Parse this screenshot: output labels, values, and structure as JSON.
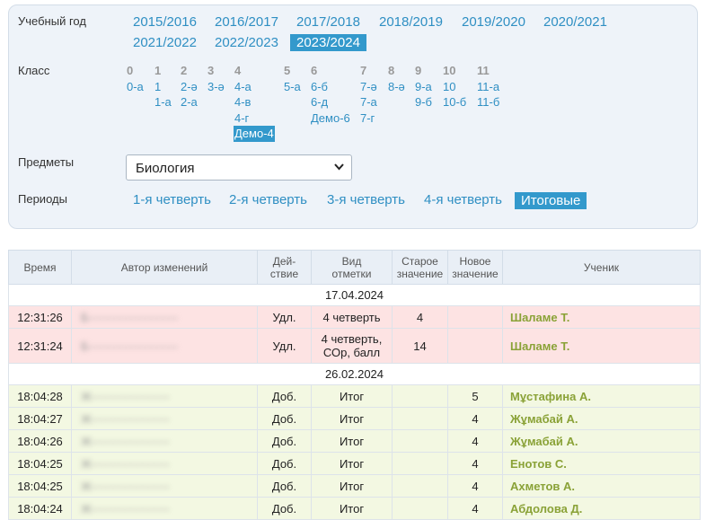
{
  "filters": {
    "year_label": "Учебный год",
    "years": [
      "2015/2016",
      "2016/2017",
      "2017/2018",
      "2018/2019",
      "2019/2020",
      "2020/2021",
      "2021/2022",
      "2022/2023",
      "2023/2024"
    ],
    "class_label": "Класс",
    "class_columns": [
      {
        "head": "0",
        "items": [
          "0-а"
        ]
      },
      {
        "head": "1",
        "items": [
          "1",
          "1-а"
        ]
      },
      {
        "head": "2",
        "items": [
          "2-ә",
          "2-а"
        ]
      },
      {
        "head": "3",
        "items": [
          "3-ә"
        ]
      },
      {
        "head": "4",
        "items": [
          "4-а",
          "4-в",
          "4-г",
          "Демо-4"
        ]
      },
      {
        "head": "5",
        "items": [
          "5-а"
        ]
      },
      {
        "head": "6",
        "items": [
          "6-б",
          "6-д",
          "Демо-6"
        ]
      },
      {
        "head": "7",
        "items": [
          "7-ә",
          "7-а",
          "7-г"
        ]
      },
      {
        "head": "8",
        "items": [
          "8-ә"
        ]
      },
      {
        "head": "9",
        "items": [
          "9-а",
          "9-б"
        ]
      },
      {
        "head": "10",
        "items": [
          "10",
          "10-б"
        ]
      },
      {
        "head": "11",
        "items": [
          "11-а",
          "11-б"
        ]
      }
    ],
    "subject_label": "Предметы",
    "subject_value": "Биология",
    "period_label": "Периоды",
    "periods": [
      "1-я четверть",
      "2-я четверть",
      "3-я четверть",
      "4-я четверть",
      "Итоговые"
    ]
  },
  "table": {
    "headers": {
      "time": "Время",
      "author": "Автор изменений",
      "action_1": "Дей-",
      "action_2": "ствие",
      "kind_1": "Вид",
      "kind_2": "отметки",
      "old_1": "Старое",
      "old_2": "значение",
      "new_1": "Новое",
      "new_2": "значение",
      "student": "Ученик"
    },
    "groups": [
      {
        "date": "17.04.2024",
        "rows": [
          {
            "time": "12:31:26",
            "author": "Б-----------------------",
            "action": "Удл.",
            "kind_1": "4 четверть",
            "kind_2": "",
            "old": "4",
            "new": "",
            "student": "Шаламе Т."
          },
          {
            "time": "12:31:24",
            "author": "Б-----------------------",
            "action": "Удл.",
            "kind_1": "4 четверть,",
            "kind_2": "СОр, балл",
            "old": "14",
            "new": "",
            "student": "Шаламе Т."
          }
        ]
      },
      {
        "date": "26.02.2024",
        "rows": [
          {
            "time": "18:04:28",
            "author": "Ж--------------------",
            "action": "Доб.",
            "kind_1": "Итог",
            "kind_2": "",
            "old": "",
            "new": "5",
            "student": "Мұстафина А."
          },
          {
            "time": "18:04:27",
            "author": "Ж--------------------",
            "action": "Доб.",
            "kind_1": "Итог",
            "kind_2": "",
            "old": "",
            "new": "4",
            "student": "Жұмабай А."
          },
          {
            "time": "18:04:26",
            "author": "Ж--------------------",
            "action": "Доб.",
            "kind_1": "Итог",
            "kind_2": "",
            "old": "",
            "new": "4",
            "student": "Жұмабай А."
          },
          {
            "time": "18:04:25",
            "author": "Ж--------------------",
            "action": "Доб.",
            "kind_1": "Итог",
            "kind_2": "",
            "old": "",
            "new": "4",
            "student": "Енотов С."
          },
          {
            "time": "18:04:25",
            "author": "Ж--------------------",
            "action": "Доб.",
            "kind_1": "Итог",
            "kind_2": "",
            "old": "",
            "new": "4",
            "student": "Ахметов А."
          },
          {
            "time": "18:04:24",
            "author": "Ж--------------------",
            "action": "Доб.",
            "kind_1": "Итог",
            "kind_2": "",
            "old": "",
            "new": "4",
            "student": "Абдолова Д."
          }
        ]
      }
    ]
  }
}
